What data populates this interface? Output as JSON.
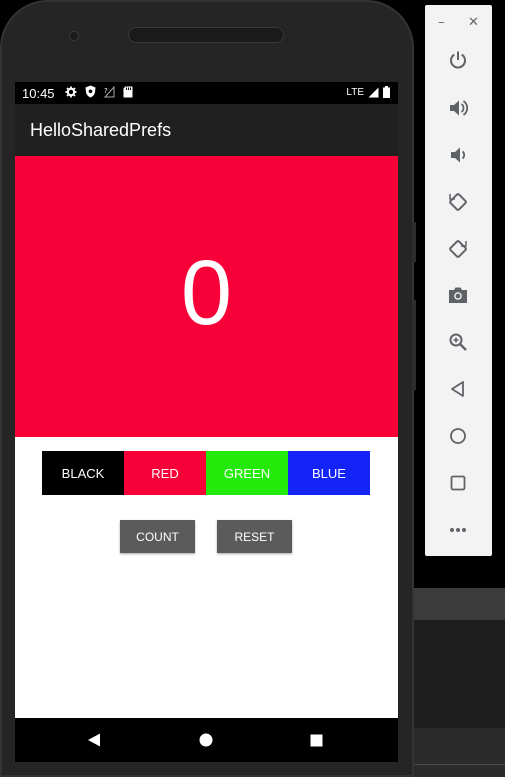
{
  "status_bar": {
    "time": "10:45",
    "network": "LTE"
  },
  "app_bar": {
    "title": "HelloSharedPrefs"
  },
  "counter": {
    "value": "0",
    "background_color": "#f80038"
  },
  "color_buttons": [
    {
      "label": "BLACK",
      "color": "#000000"
    },
    {
      "label": "RED",
      "color": "#f80038"
    },
    {
      "label": "GREEN",
      "color": "#24ea0c"
    },
    {
      "label": "BLUE",
      "color": "#1524f6"
    }
  ],
  "actions": {
    "count_label": "COUNT",
    "reset_label": "RESET"
  },
  "emulator_toolbar": {
    "icons": [
      "power-icon",
      "volume-up-icon",
      "volume-down-icon",
      "rotate-left-icon",
      "rotate-right-icon",
      "camera-icon",
      "zoom-icon",
      "back-icon",
      "home-icon",
      "overview-icon",
      "more-icon"
    ]
  }
}
